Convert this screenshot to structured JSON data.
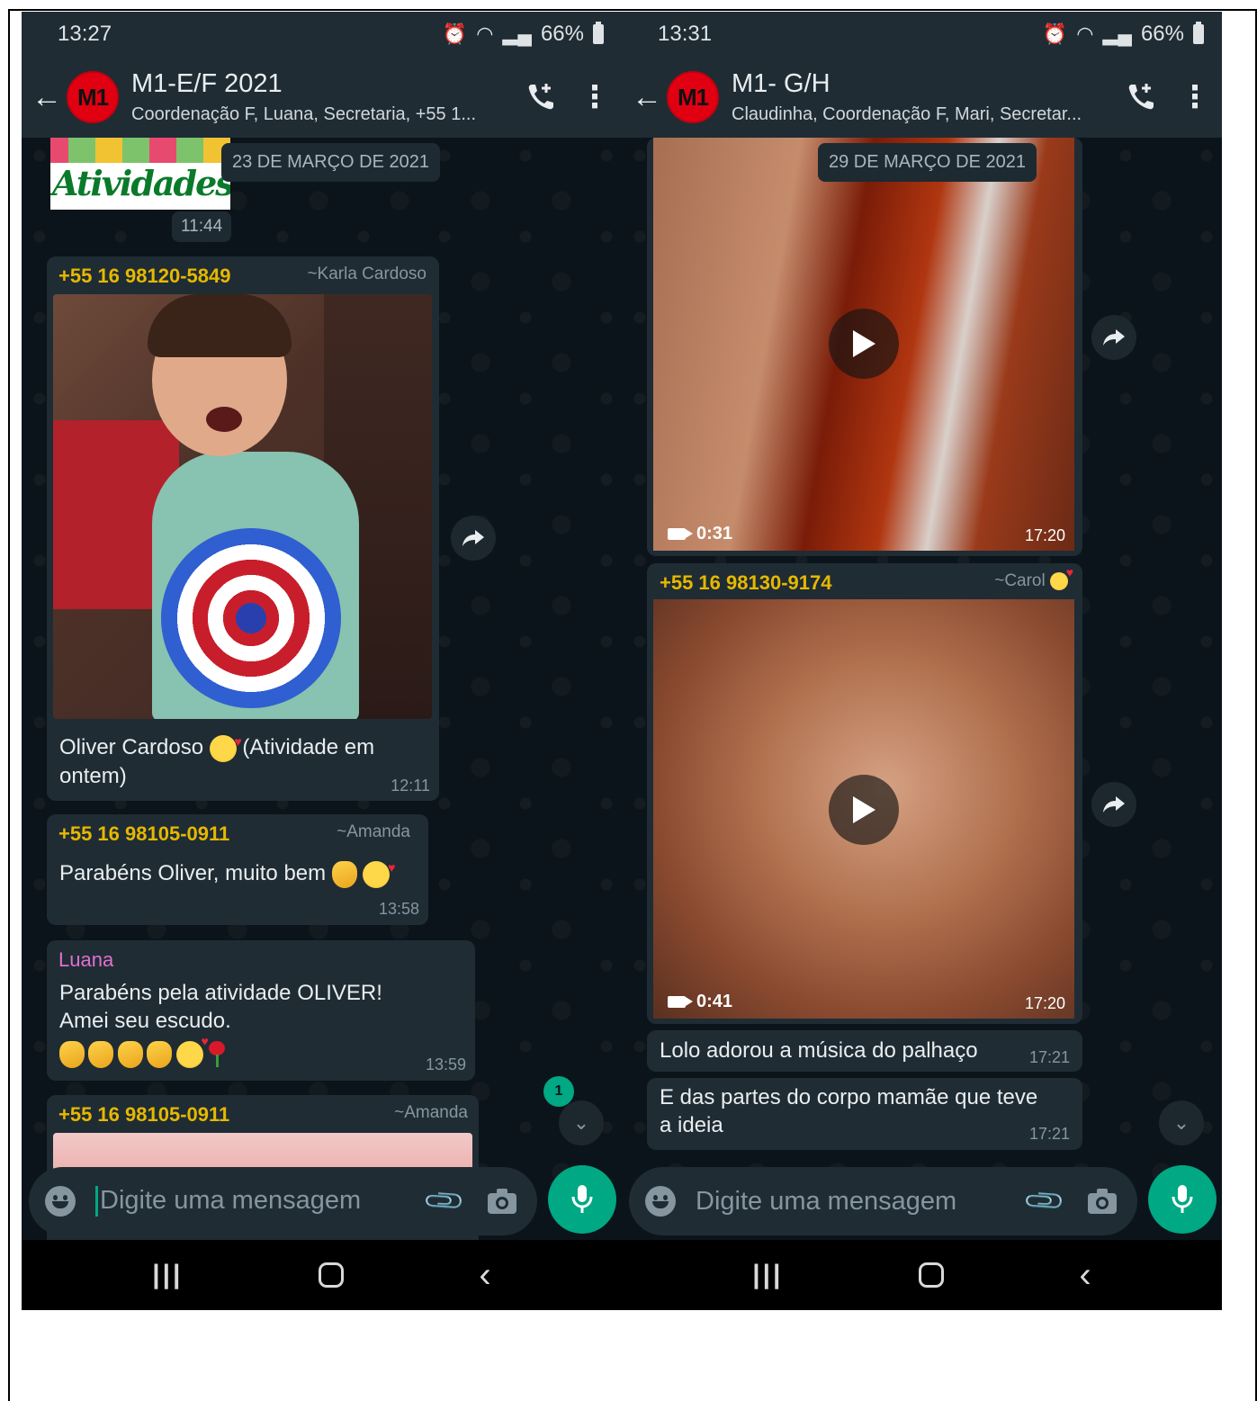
{
  "left": {
    "status": {
      "time": "13:27",
      "battery": "66%"
    },
    "header": {
      "avatar": "M1",
      "title": "M1-E/F  2021",
      "subtitle": "Coordenação F, Luana, Secretaria, +55 1..."
    },
    "sticker_text": "Atividades",
    "date_pill": "23 DE MARÇO DE 2021",
    "sticker_time": "11:44",
    "messages": [
      {
        "sender": "+55 16 98120-5849",
        "alias": "~Karla Cardoso",
        "text1": "Oliver Cardoso",
        "text2": "(Atividade em",
        "text3": "ontem)",
        "time": "12:11"
      },
      {
        "sender": "+55 16 98105-0911",
        "alias": "~Amanda",
        "text": "Parabéns Oliver, muito bem",
        "time": "13:58"
      },
      {
        "sender": "Luana",
        "line1": "Parabéns  pela atividade OLIVER!",
        "line2": "Amei seu escudo.",
        "time": "13:59"
      },
      {
        "sender": "+55 16 98105-0911",
        "alias": "~Amanda"
      }
    ],
    "unread_count": "1",
    "input_placeholder": "Digite uma mensagem"
  },
  "right": {
    "status": {
      "time": "13:31",
      "battery": "66%"
    },
    "header": {
      "avatar": "M1",
      "title": "M1- G/H",
      "subtitle": "Claudinha, Coordenação F, Mari, Secretar..."
    },
    "date_pill": "29 DE MARÇO DE 2021",
    "video1": {
      "duration": "0:31",
      "time": "17:20"
    },
    "msg2": {
      "sender": "+55 16 98130-9174",
      "alias": "~Carol"
    },
    "video2": {
      "duration": "0:41",
      "time": "17:20"
    },
    "msg3": {
      "text": "Lolo adorou a música do palhaço",
      "time": "17:21"
    },
    "msg4": {
      "line1": "E das partes do corpo mamãe que teve",
      "line2": "a ideia",
      "time": "17:21"
    },
    "input_placeholder": "Digite uma mensagem"
  },
  "colors": {
    "accent": "#00a884",
    "bubble": "#1f2c34",
    "background": "#0b141a",
    "sender_yellow": "#e6b800",
    "sender_pink": "#e070d0"
  },
  "icons": [
    "back-arrow-icon",
    "call-add-icon",
    "menu-dots-icon",
    "forward-icon",
    "play-icon",
    "video-camera-icon",
    "scroll-down-icon",
    "emoji-icon",
    "attach-icon",
    "camera-icon",
    "mic-icon",
    "nav-recent-icon",
    "nav-home-icon",
    "nav-back-icon"
  ]
}
